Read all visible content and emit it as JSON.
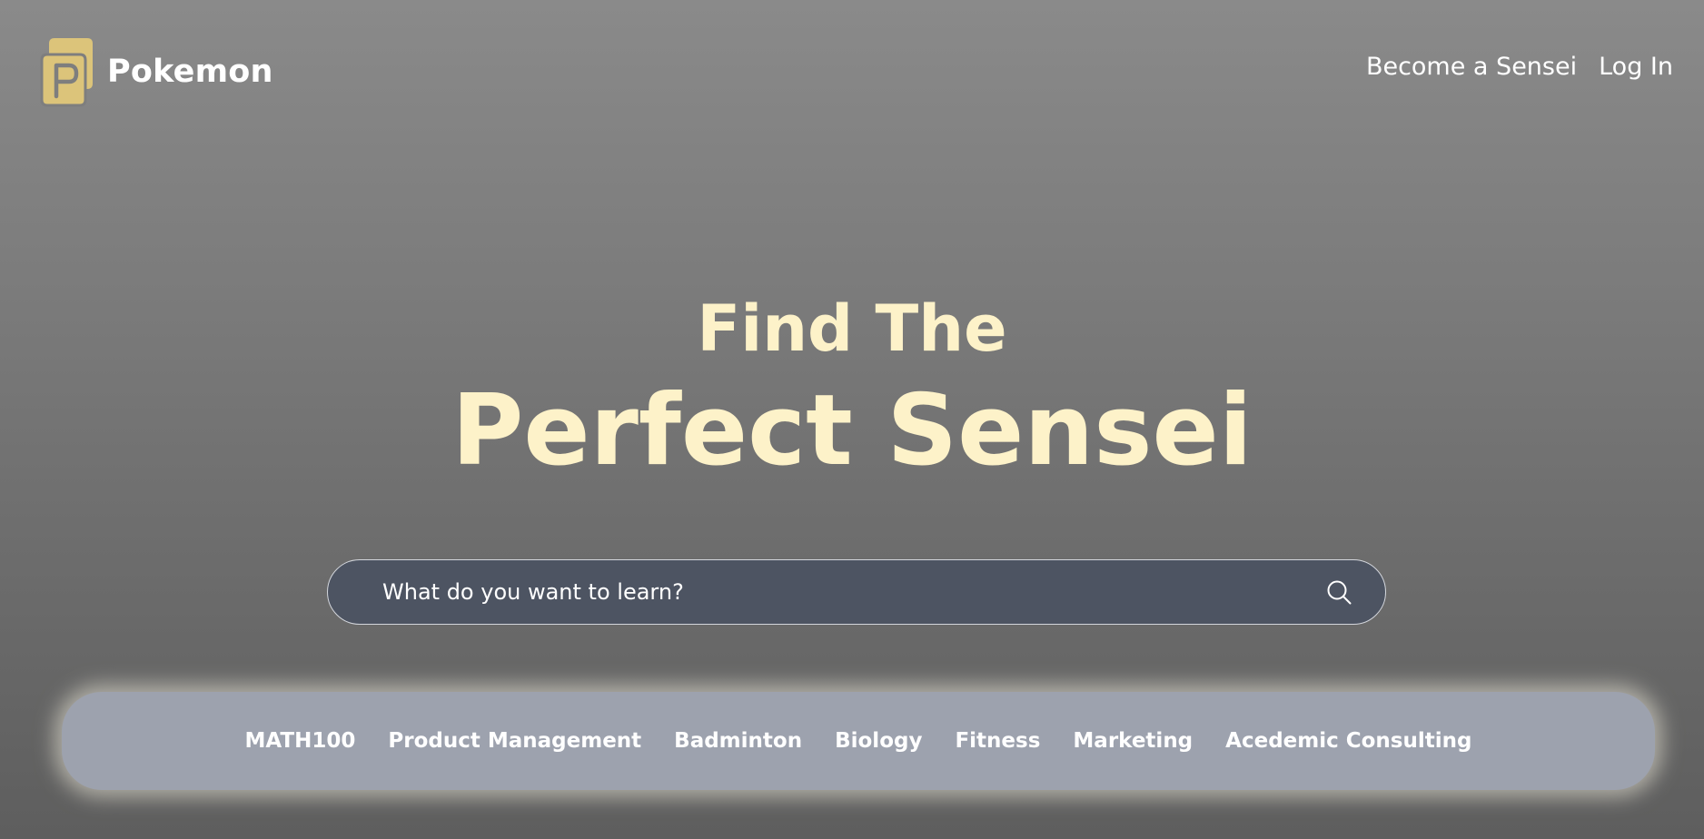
{
  "brand": {
    "name": "Pokemon",
    "logo_icon": "pokemon-p-logo-icon",
    "logo_color": "#dcc47a"
  },
  "nav": {
    "become_sensei": "Become a Sensei",
    "login": "Log In"
  },
  "hero": {
    "line1": "Find The",
    "line2": "Perfect Sensei",
    "color": "#fdf2c9"
  },
  "search": {
    "placeholder": "What do you want to learn?",
    "value": "",
    "icon": "search-icon",
    "background": "#4d5462"
  },
  "categories": [
    "MATH100",
    "Product Management",
    "Badminton",
    "Biology",
    "Fitness",
    "Marketing",
    "Acedemic Consulting"
  ],
  "colors": {
    "chips_bar": "#9da2ae",
    "text": "#ffffff"
  }
}
